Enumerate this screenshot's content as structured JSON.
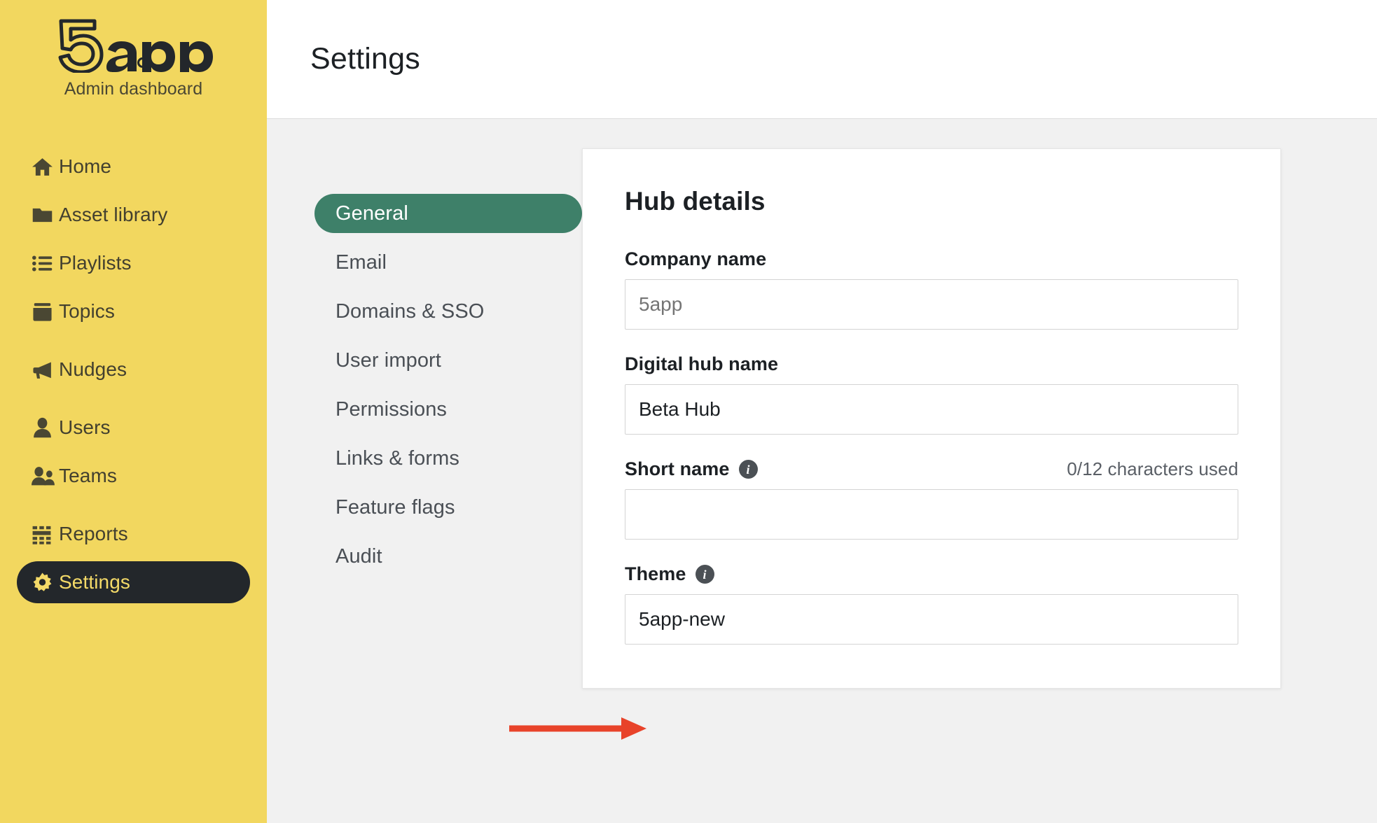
{
  "brand": {
    "logo_text": "5app",
    "logo_icon": "5app-logo",
    "subtitle": "Admin dashboard"
  },
  "colors": {
    "sidebar_yellow": "#F2D75F",
    "active_nav_dark": "#23272B",
    "active_nav_text": "#F4DA68",
    "tab_green": "#3E8069",
    "annotation_red": "#E8432A",
    "page_background": "#F1F1F1",
    "text_dark": "#1C2024"
  },
  "sidebar": {
    "items": [
      {
        "label": "Home",
        "icon": "home-icon",
        "active": false
      },
      {
        "label": "Asset library",
        "icon": "folder-open-icon",
        "active": false
      },
      {
        "label": "Playlists",
        "icon": "list-ul-icon",
        "active": false
      },
      {
        "label": "Topics",
        "icon": "archive-box-icon",
        "active": false
      },
      {
        "label": "Nudges",
        "icon": "megaphone-icon",
        "active": false
      },
      {
        "label": "Users",
        "icon": "user-icon",
        "active": false
      },
      {
        "label": "Teams",
        "icon": "users-group-icon",
        "active": false
      },
      {
        "label": "Reports",
        "icon": "table-grid-icon",
        "active": false
      },
      {
        "label": "Settings",
        "icon": "gear-icon",
        "active": true
      }
    ]
  },
  "header": {
    "title": "Settings"
  },
  "settings_tabs": [
    {
      "label": "General",
      "active": true
    },
    {
      "label": "Email",
      "active": false
    },
    {
      "label": "Domains & SSO",
      "active": false
    },
    {
      "label": "User import",
      "active": false
    },
    {
      "label": "Permissions",
      "active": false
    },
    {
      "label": "Links & forms",
      "active": false
    },
    {
      "label": "Feature flags",
      "active": false
    },
    {
      "label": "Audit",
      "active": false
    }
  ],
  "card": {
    "title": "Hub details",
    "fields": {
      "company_name": {
        "label": "Company name",
        "value": "",
        "placeholder": "5app"
      },
      "digital_hub_name": {
        "label": "Digital hub name",
        "value": "Beta Hub",
        "placeholder": ""
      },
      "short_name": {
        "label": "Short name",
        "value": "",
        "placeholder": "",
        "info_icon": "info-icon",
        "counter": "0/12 characters used"
      },
      "theme": {
        "label": "Theme",
        "value": "5app-new",
        "placeholder": "",
        "info_icon": "info-icon"
      }
    }
  },
  "annotation": {
    "type": "arrow",
    "direction": "right",
    "points_to": "theme-input",
    "color": "#E8432A"
  }
}
